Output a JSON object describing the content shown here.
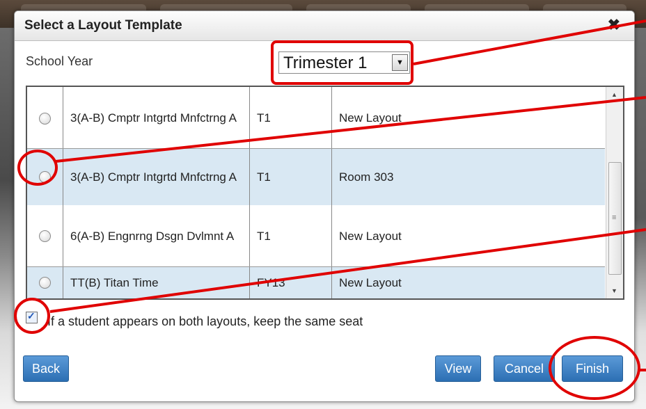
{
  "dialog": {
    "title": "Select a Layout Template",
    "close_icon": "close-icon"
  },
  "school_year": {
    "label": "School Year",
    "selected": "Trimester 1"
  },
  "table": {
    "rows": [
      {
        "course": "3(A-B) Cmptr Intgrtd Mnfctrng A",
        "term": "T1",
        "layout": "New Layout"
      },
      {
        "course": "3(A-B) Cmptr Intgrtd Mnfctrng A",
        "term": "T1",
        "layout": "Room 303"
      },
      {
        "course": "6(A-B) Engnrng Dsgn Dvlmnt A",
        "term": "T1",
        "layout": "New Layout"
      },
      {
        "course": "TT(B) Titan Time",
        "term": "FY13",
        "layout": "New Layout"
      }
    ]
  },
  "keep_seat": {
    "label": "If a student appears on both layouts, keep the same seat",
    "checked": true
  },
  "buttons": {
    "back": "Back",
    "view": "View",
    "cancel": "Cancel",
    "finish": "Finish"
  },
  "colors": {
    "button": "#2c6fb3",
    "annotation": "#e00000",
    "row_alt": "#d9e8f3"
  }
}
